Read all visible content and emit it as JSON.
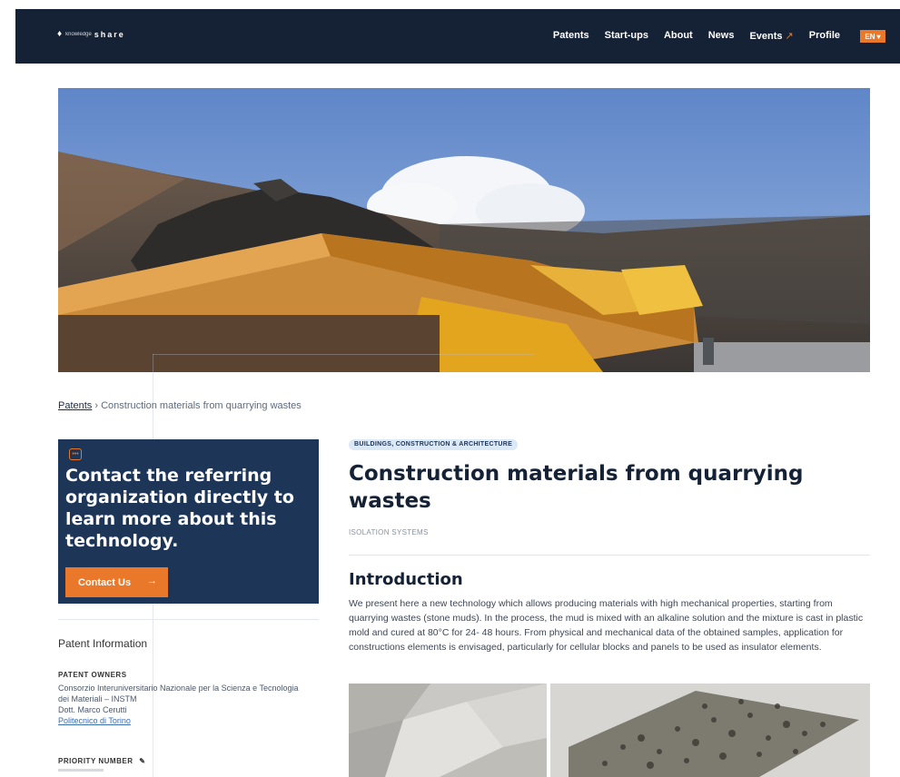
{
  "brand": {
    "logo_small": "knowledge",
    "logo_big": "share"
  },
  "nav": {
    "items": [
      "Patents",
      "Start-ups",
      "About",
      "News",
      "Events"
    ],
    "events_ext": "↗",
    "profile": "Profile",
    "lang": "EN",
    "lang_caret": "▾"
  },
  "breadcrumb": {
    "root": "Patents",
    "sep": "›",
    "current": "Construction materials from quarrying wastes"
  },
  "contact": {
    "icon": "chat-icon",
    "heading": "Contact the referring organization directly to learn more about this technology.",
    "button": "Contact Us",
    "button_arrow": "→"
  },
  "patent_info": {
    "title": "Patent Information",
    "owners_label": "PATENT OWNERS",
    "owners": [
      "Consorzio Interuniversitario Nazionale per la Scienza e Tecnologia dei Materiali – INSTM",
      "Dott. Marco Cerutti"
    ],
    "owner_link": "Politecnico di Torino",
    "priority_label": "PRIORITY NUMBER",
    "priority_icon": "info-icon"
  },
  "article": {
    "category": "BUILDINGS, CONSTRUCTION & ARCHITECTURE",
    "title": "Construction materials from quarrying wastes",
    "subtag": "ISOLATION SYSTEMS",
    "intro_heading": "Introduction",
    "intro_text": "We present here a new technology which allows producing materials with high mechanical properties, starting from quarrying wastes (stone muds). In the process, the mud is mixed with an alkaline solution and the mixture is cast in plastic mold and cured at 80°C for 24- 48 hours. From physical and mechanical data of the obtained samples, application for constructions elements is envisaged, particularly for cellular blocks and panels to be used as insulator elements."
  },
  "colors": {
    "navy": "#152235",
    "card": "#1d3557",
    "accent": "#e9782b",
    "pill_bg": "#dbe8f5"
  }
}
